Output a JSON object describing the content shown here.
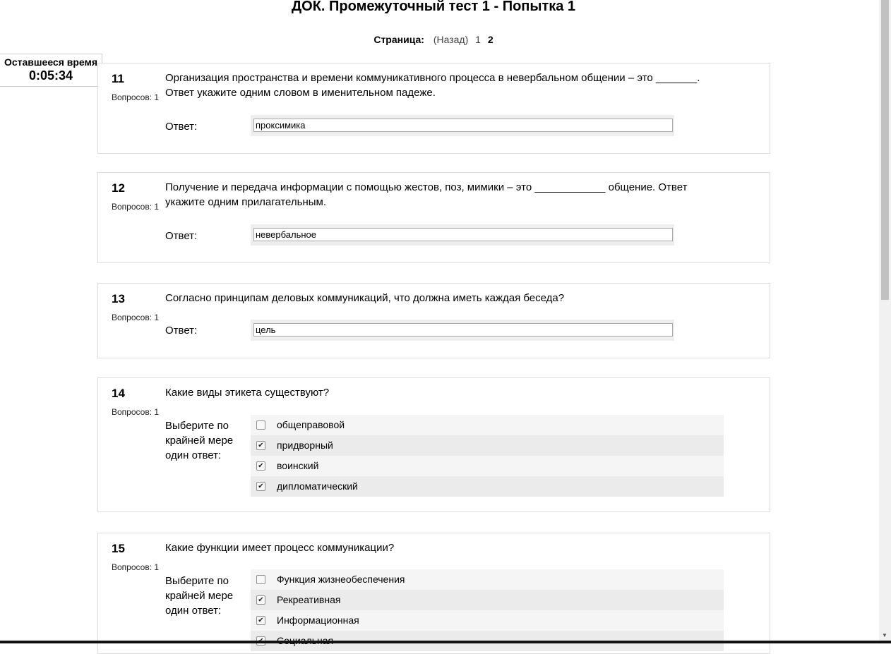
{
  "page": {
    "title": "ДОК. Промежуточный тест 1 - Попытка 1",
    "pager": {
      "label": "Страница:",
      "back": "(Назад)",
      "page1": "1",
      "current": "2"
    }
  },
  "timer": {
    "label": "Оставшееся время",
    "value": "0:05:34"
  },
  "questions": [
    {
      "num": "11",
      "marks": "Вопросов: 1",
      "text": "Организация пространства и времени коммуникативного процесса в невербальном общении – это _______. Ответ укажите одним словом в именительном падеже.",
      "answer_label": "Ответ:",
      "answer": "проксимика"
    },
    {
      "num": "12",
      "marks": "Вопросов: 1",
      "text": "Получение и передача информации с помощью жестов, поз, мимики – это ____________ общение. Ответ укажите одним прилагательным.",
      "answer_label": "Ответ:",
      "answer": "невербальное"
    },
    {
      "num": "13",
      "marks": "Вопросов: 1",
      "text": "Согласно принципам деловых коммуникаций, что должна иметь каждая беседа?",
      "answer_label": "Ответ:",
      "answer": "цель"
    },
    {
      "num": "14",
      "marks": "Вопросов: 1",
      "text": "Какие виды этикета существуют?",
      "answer_label": "Выберите по крайней мере один ответ:",
      "choices": [
        {
          "label": "общеправовой",
          "checked": false
        },
        {
          "label": "придворный",
          "checked": true
        },
        {
          "label": "воинский",
          "checked": true
        },
        {
          "label": "дипломатический",
          "checked": true
        }
      ]
    },
    {
      "num": "15",
      "marks": "Вопросов: 1",
      "text": "Какие функции имеет процесс коммуникации?",
      "answer_label": "Выберите по крайней мере один ответ:",
      "choices": [
        {
          "label": "Функция жизнеобеспечения",
          "checked": false
        },
        {
          "label": "Рекреативная",
          "checked": true
        },
        {
          "label": "Информационная",
          "checked": true
        },
        {
          "label": "Социальная",
          "checked": true
        }
      ]
    }
  ]
}
